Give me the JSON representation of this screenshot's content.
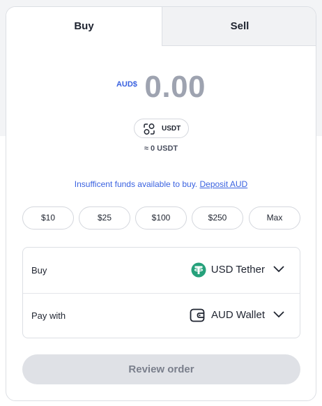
{
  "tabs": {
    "buy": "Buy",
    "sell": "Sell"
  },
  "amount": {
    "currency": "AUD$",
    "value": "0.00"
  },
  "asset": {
    "label": "USDT",
    "approx": "≈ 0 USDT"
  },
  "notice": {
    "text": "Insufficent funds available to buy.",
    "link": "Deposit AUD"
  },
  "quick_amounts": [
    "$10",
    "$25",
    "$100",
    "$250",
    "Max"
  ],
  "buy_row": {
    "label": "Buy",
    "value": "USD Tether",
    "icon": "tether-icon"
  },
  "pay_row": {
    "label": "Pay with",
    "value": "AUD Wallet",
    "icon": "wallet-icon"
  },
  "review_button": "Review order",
  "colors": {
    "accent": "#3a62e0",
    "tether": "#26a17b",
    "disabled_button": "#dfe1e6"
  }
}
